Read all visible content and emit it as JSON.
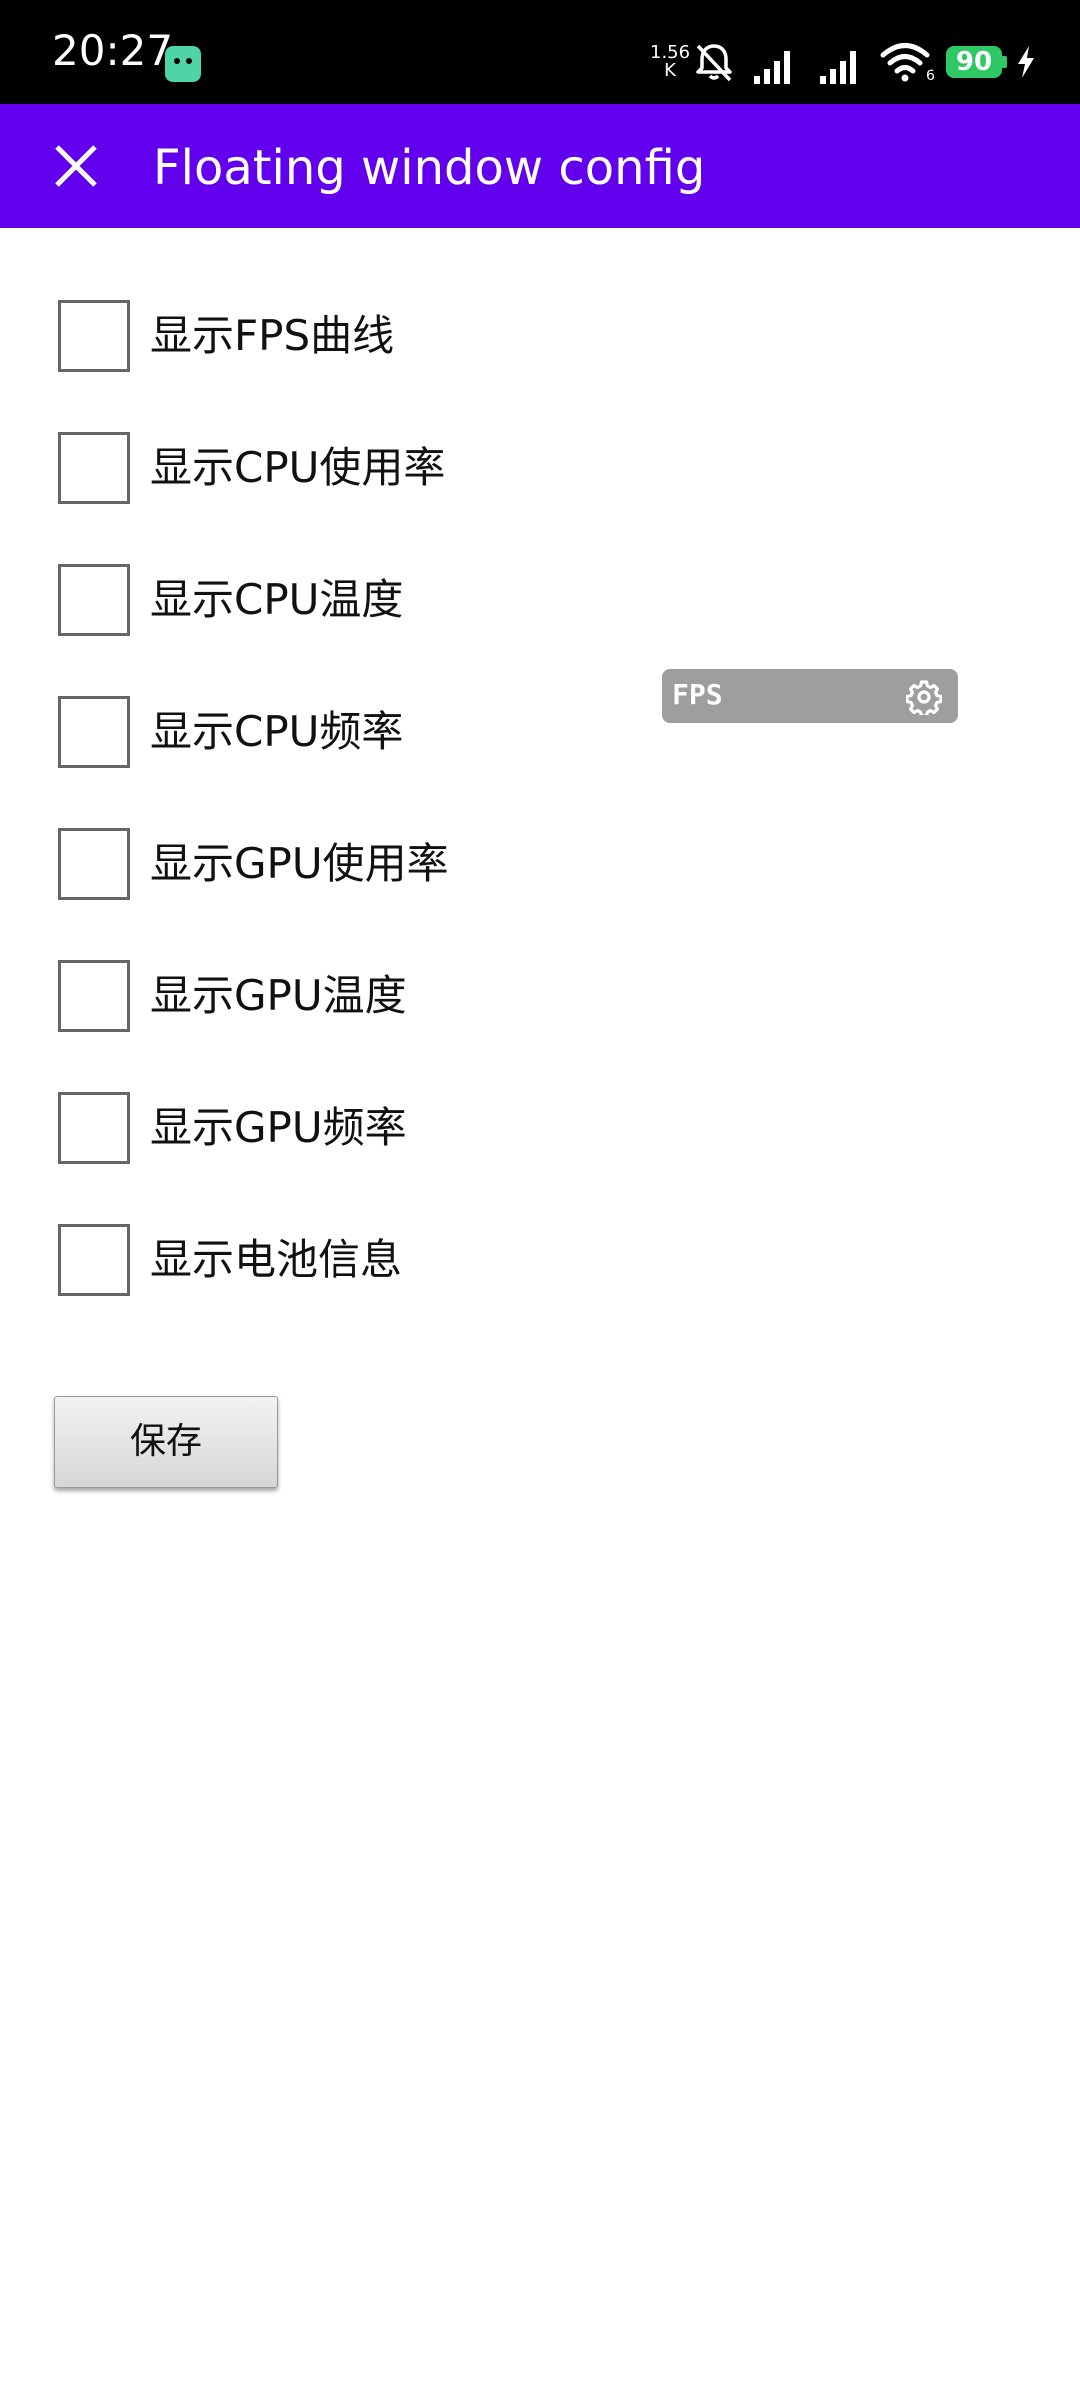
{
  "status_bar": {
    "time": "20:27",
    "net_speed_value": "1.56",
    "net_speed_unit": "K",
    "wifi_sub": "6",
    "battery_level": "90",
    "battery_color": "#2ec866",
    "icons": [
      "app-notification-icon",
      "bell-off-icon",
      "signal-icon",
      "signal-icon",
      "wifi-icon",
      "battery-icon",
      "charging-icon"
    ]
  },
  "app_bar": {
    "title": "Floating window config",
    "background": "#6200ee",
    "close_icon": "close-icon"
  },
  "options": [
    {
      "label": "显示FPS曲线",
      "checked": false
    },
    {
      "label": "显示CPU使用率",
      "checked": false
    },
    {
      "label": "显示CPU温度",
      "checked": false
    },
    {
      "label": "显示CPU频率",
      "checked": false
    },
    {
      "label": "显示GPU使用率",
      "checked": false
    },
    {
      "label": "显示GPU温度",
      "checked": false
    },
    {
      "label": "显示GPU频率",
      "checked": false
    },
    {
      "label": "显示电池信息",
      "checked": false
    }
  ],
  "save_button": {
    "label": "保存"
  },
  "fps_widget": {
    "label": "FPS",
    "settings_icon": "gear-icon"
  }
}
